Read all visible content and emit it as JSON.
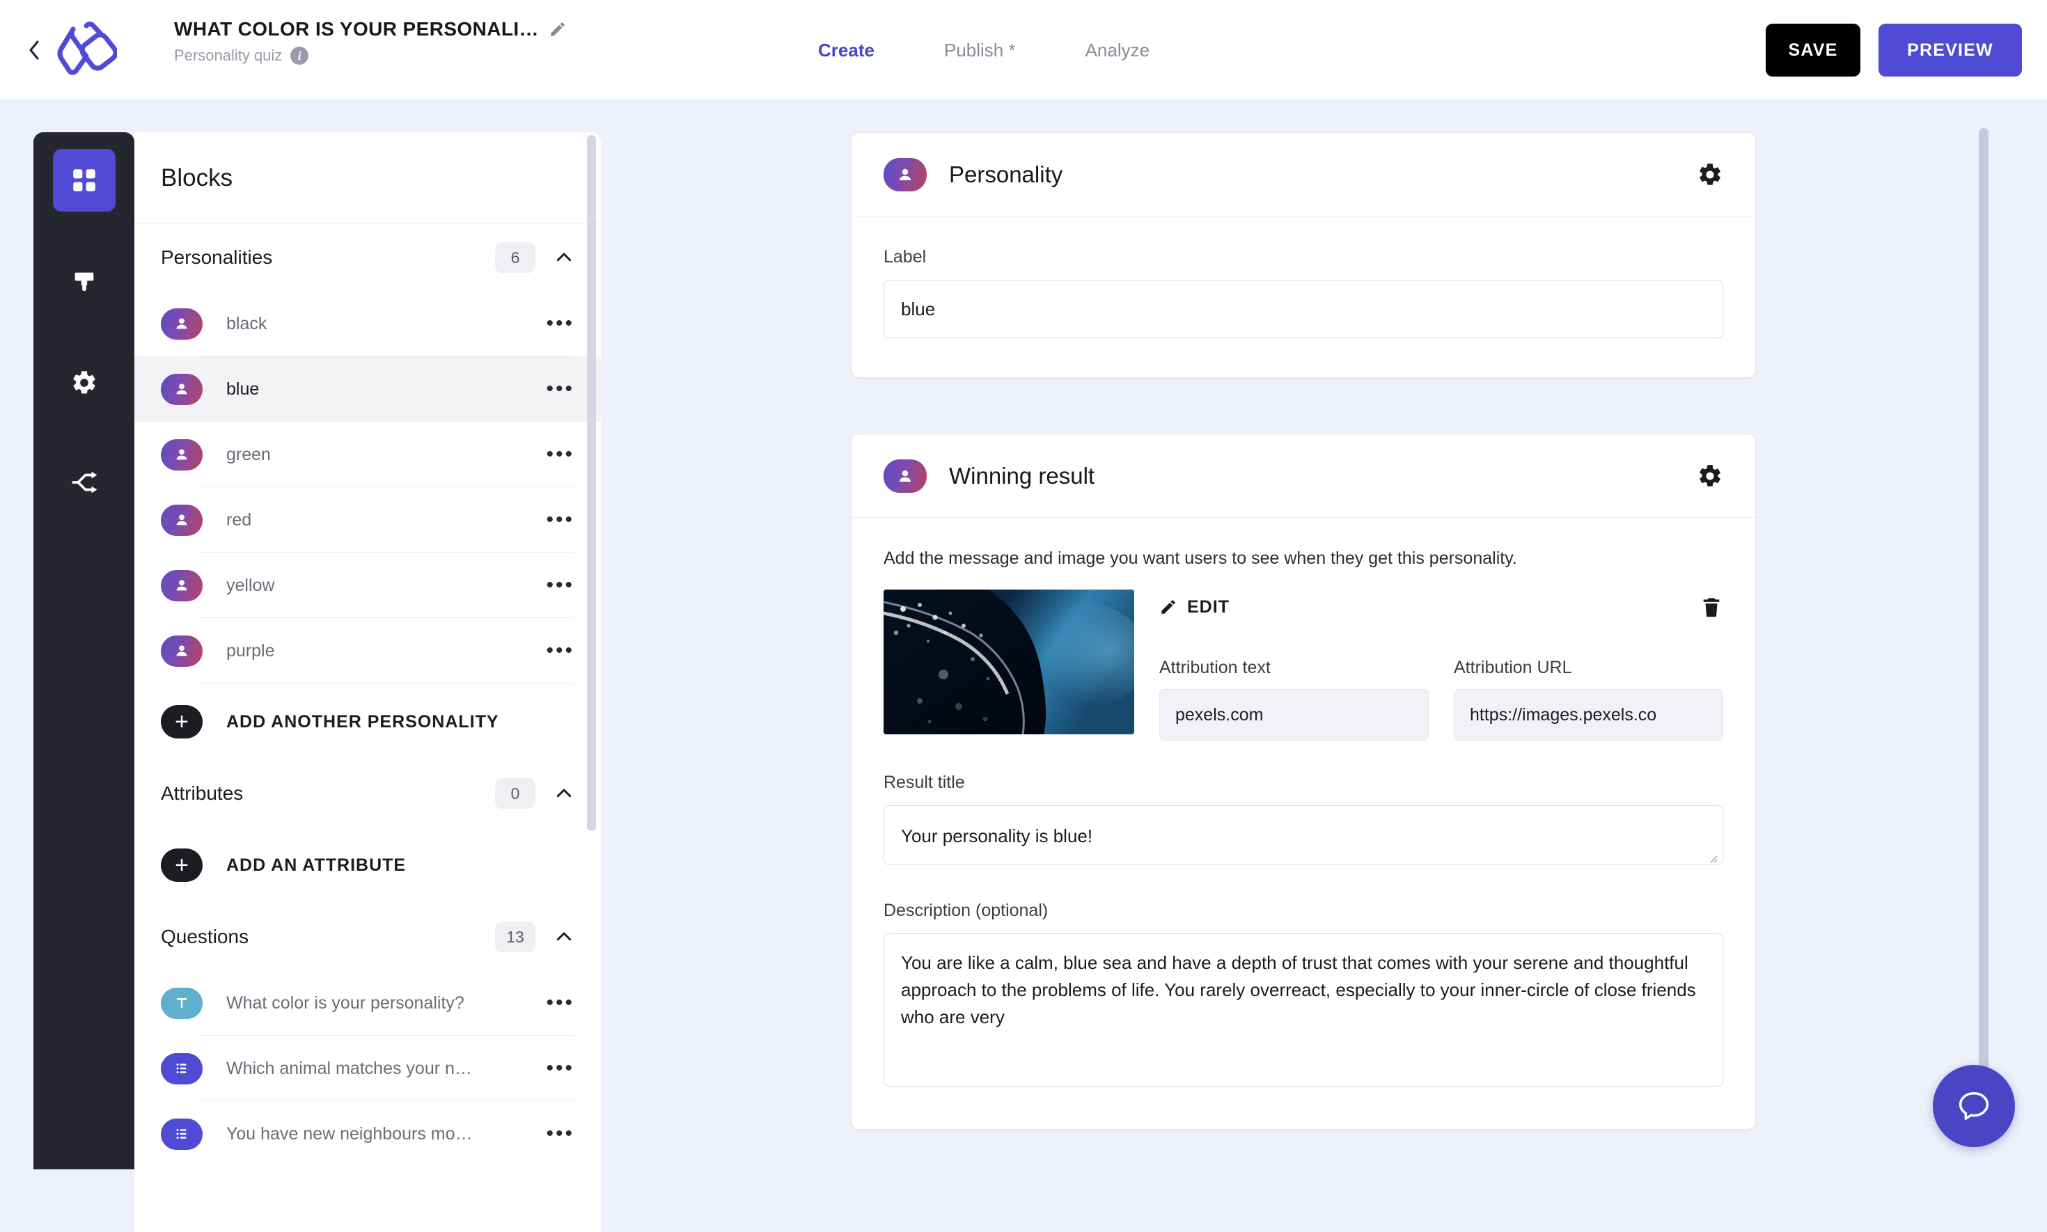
{
  "header": {
    "back_icon": "chevron-left-icon",
    "logo_icon": "typeform-logo-icon",
    "doc_title": "WHAT COLOR IS YOUR PERSONALI…",
    "edit_title_icon": "pencil-icon",
    "subtitle": "Personality quiz",
    "info_icon": "info-icon",
    "info_glyph": "i",
    "nav": [
      {
        "label": "Create",
        "active": true
      },
      {
        "label": "Publish *",
        "active": false
      },
      {
        "label": "Analyze",
        "active": false
      }
    ],
    "save_label": "SAVE",
    "preview_label": "PREVIEW",
    "accent_color": "#4f4bd4",
    "save_bg": "#000000"
  },
  "rail": {
    "items": [
      {
        "name": "blocks-icon",
        "active": true
      },
      {
        "name": "design-brush-icon",
        "active": false
      },
      {
        "name": "settings-gear-icon",
        "active": false
      },
      {
        "name": "logic-branch-icon",
        "active": false
      }
    ]
  },
  "blocks_panel": {
    "heading": "Blocks",
    "sections": [
      {
        "title": "Personalities",
        "count": "6",
        "collapse_icon": "chevron-up-icon",
        "items": [
          {
            "label": "black",
            "icon": "personality-avatar-icon",
            "selected": false
          },
          {
            "label": "blue",
            "icon": "personality-avatar-icon",
            "selected": true
          },
          {
            "label": "green",
            "icon": "personality-avatar-icon",
            "selected": false
          },
          {
            "label": "red",
            "icon": "personality-avatar-icon",
            "selected": false
          },
          {
            "label": "yellow",
            "icon": "personality-avatar-icon",
            "selected": false
          },
          {
            "label": "purple",
            "icon": "personality-avatar-icon",
            "selected": false
          }
        ],
        "add_label": "ADD ANOTHER PERSONALITY",
        "add_icon": "plus-icon"
      },
      {
        "title": "Attributes",
        "count": "0",
        "collapse_icon": "chevron-up-icon",
        "items": [],
        "add_label": "ADD AN ATTRIBUTE",
        "add_icon": "plus-icon"
      },
      {
        "title": "Questions",
        "count": "13",
        "collapse_icon": "chevron-up-icon",
        "items": [
          {
            "label": "What color is your personality?",
            "icon": "short-text-icon",
            "type": "text"
          },
          {
            "label": "Which animal matches your n…",
            "icon": "multiple-choice-icon",
            "type": "choice"
          },
          {
            "label": "You have new neighbours mo…",
            "icon": "multiple-choice-icon",
            "type": "choice"
          }
        ]
      }
    ],
    "row_menu_icon": "ellipsis-icon",
    "row_menu_glyph": "•••"
  },
  "personality_card": {
    "icon": "personality-avatar-icon",
    "title": "Personality",
    "settings_icon": "gear-icon",
    "label_field_label": "Label",
    "label_field_value": "blue"
  },
  "winning_result_card": {
    "icon": "personality-avatar-icon",
    "title": "Winning result",
    "settings_icon": "gear-icon",
    "helper_text": "Add the message and image you want users to see when they get this personality.",
    "image_icon": "ocean-underwater-thumbnail",
    "edit_icon": "pencil-icon",
    "edit_label": "EDIT",
    "delete_icon": "trash-icon",
    "attribution_text_label": "Attribution text",
    "attribution_text_value": "pexels.com",
    "attribution_url_label": "Attribution URL",
    "attribution_url_value": "https://images.pexels.co",
    "result_title_label": "Result title",
    "result_title_value": "Your personality is blue!",
    "description_label": "Description (optional)",
    "description_value": "You are like a calm, blue sea and have a depth of trust that comes with your serene and thoughtful approach to the problems of life. You rarely overreact, especially to your inner-circle of close friends who are very"
  },
  "chat_widget": {
    "icon": "chat-bubble-icon",
    "color": "#4a45c4"
  }
}
